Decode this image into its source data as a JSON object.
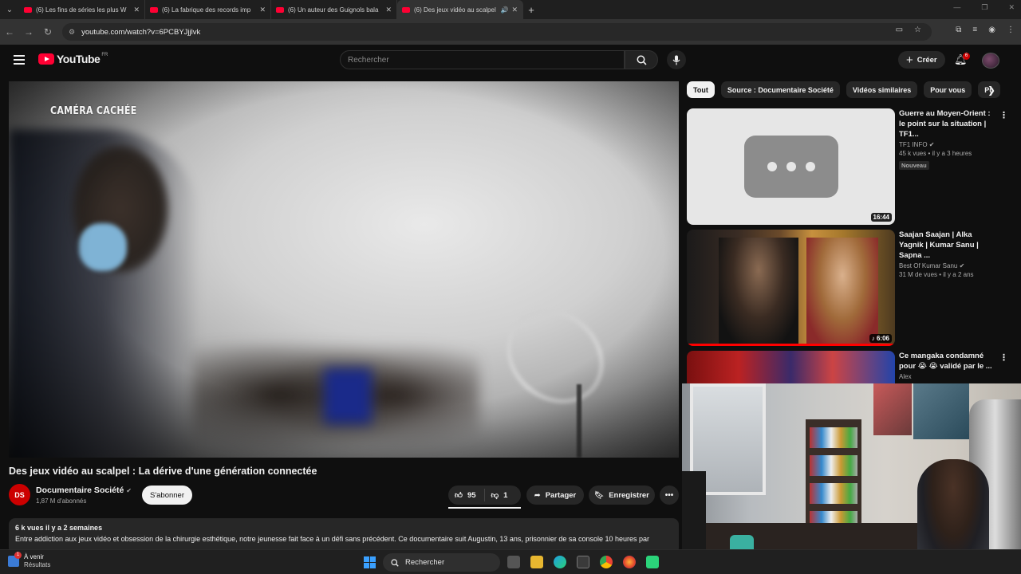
{
  "browser": {
    "tabs": [
      {
        "title": "(6) Les fins de séries les plus W",
        "active": false,
        "audio": false
      },
      {
        "title": "(6) La fabrique des records imp",
        "active": false,
        "audio": false
      },
      {
        "title": "(6) Un auteur des Guignols bala",
        "active": false,
        "audio": false
      },
      {
        "title": "(6) Des jeux vidéo au scalpel",
        "active": true,
        "audio": true
      }
    ],
    "url": "youtube.com/watch?v=6PCBYJjjlvk"
  },
  "header": {
    "logo_text": "YouTube",
    "country": "FR",
    "search_placeholder": "Rechercher",
    "create_label": "Créer",
    "notifications_count": "6"
  },
  "video": {
    "overlay_text": "CAMÉRA CACHÉE",
    "title": "Des jeux vidéo au scalpel : La dérive d'une génération connectée",
    "channel": {
      "name": "Documentaire Société",
      "subscribers": "1,87 M d'abonnés",
      "avatar_text": "DS"
    },
    "subscribe_label": "S'abonner",
    "likes": "95",
    "dislikes": "1",
    "share_label": "Partager",
    "save_label": "Enregistrer",
    "description": {
      "meta": "6 k vues  il y a 2 semaines",
      "text": "Entre addiction aux jeux vidéo et obsession de la chirurgie esthétique, notre jeunesse fait face à un défi sans précédent. Ce documentaire suit Augustin, 13 ans, prisonnier de sa console 10 heures par"
    }
  },
  "sidebar": {
    "chips": [
      {
        "label": "Tout",
        "active": true
      },
      {
        "label": "Source : Documentaire Société",
        "active": false
      },
      {
        "label": "Vidéos similaires",
        "active": false
      },
      {
        "label": "Pour vous",
        "active": false
      },
      {
        "label": "Pu",
        "active": false
      }
    ],
    "recommendations": [
      {
        "title": "Guerre au Moyen-Orient : le point sur la situation | TF1...",
        "channel": "TF1 INFO",
        "meta": "45 k vues • il y a 3 heures",
        "badge": "Nouveau",
        "duration": "16:44"
      },
      {
        "title": "Saajan Saajan | Alka Yagnik | Kumar Sanu | Sapna ...",
        "channel": "Best Of Kumar Sanu",
        "meta": "31 M de vues • il y a 2 ans",
        "badge": "",
        "duration": "6:06"
      },
      {
        "title": "Ce mangaka condamné pour 😭 😭 validé par le ...",
        "channel": "Alex",
        "meta": "",
        "badge": "",
        "duration": ""
      }
    ]
  },
  "taskbar": {
    "weather_title": "À venir",
    "weather_sub": "Résultats",
    "weather_badge": "1",
    "search_label": "Rechercher"
  },
  "colors": {
    "brand_red": "#ff0033",
    "background": "#0f0f0f",
    "surface": "#272727"
  }
}
